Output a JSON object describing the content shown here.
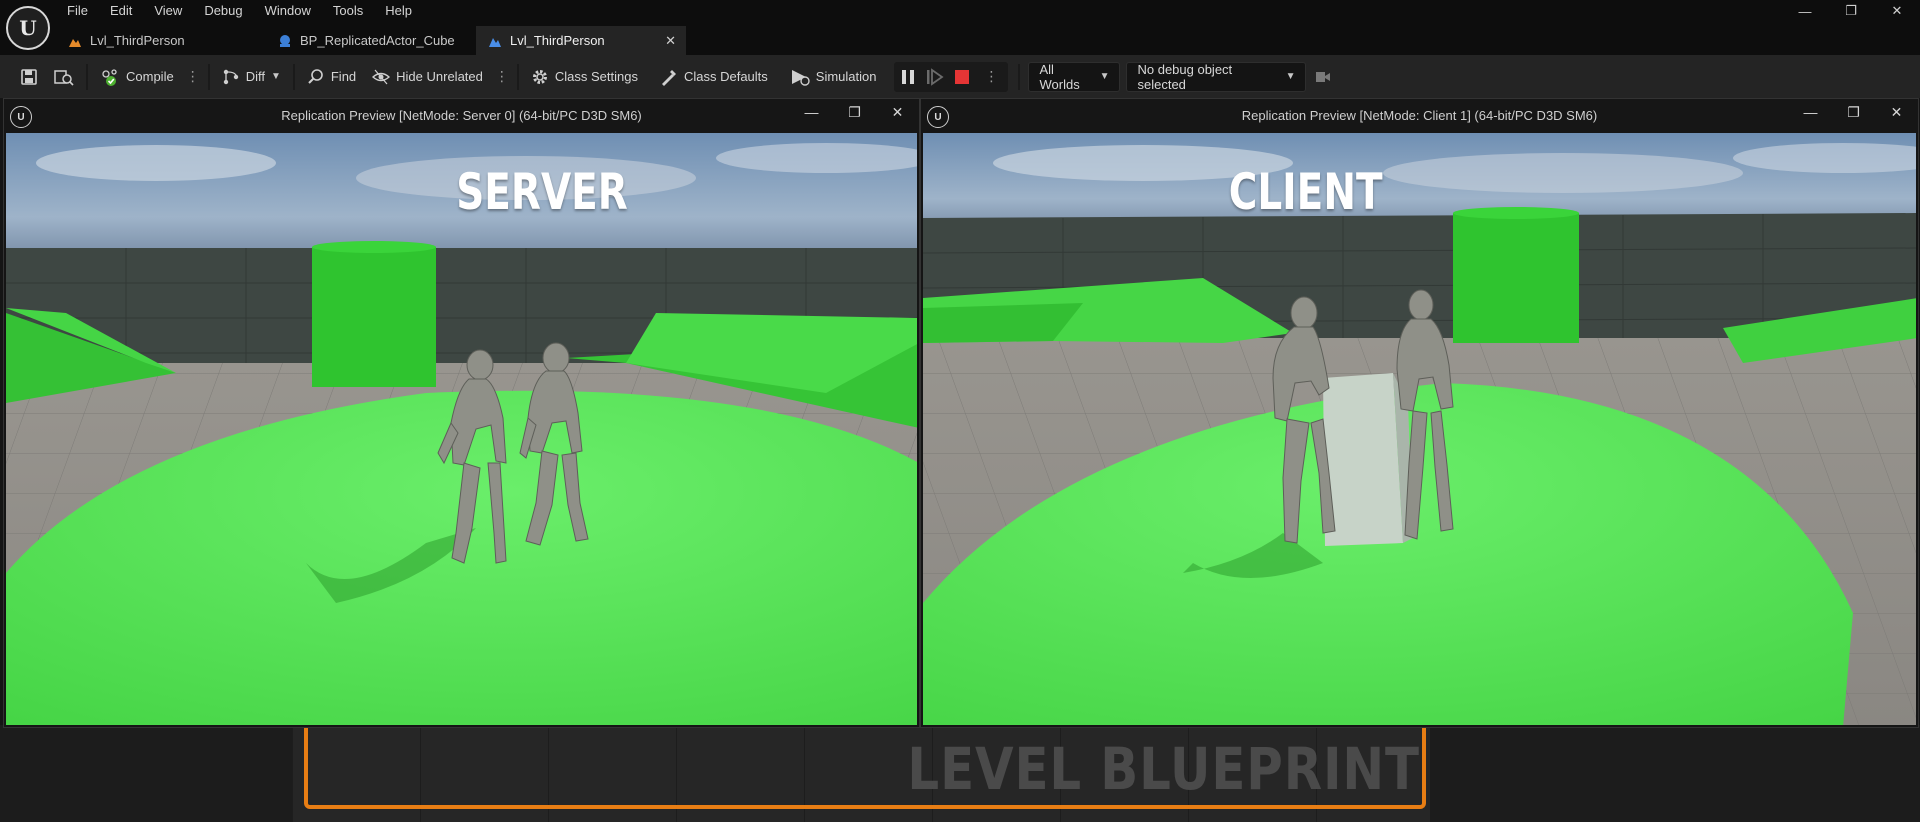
{
  "menu": [
    "File",
    "Edit",
    "View",
    "Debug",
    "Window",
    "Tools",
    "Help"
  ],
  "window_controls": {
    "minimize": "—",
    "maximize": "❐",
    "close": "✕"
  },
  "tabs": [
    {
      "label": "Lvl_ThirdPerson",
      "icon": "level-icon",
      "active": false
    },
    {
      "label": "BP_ReplicatedActor_Cube",
      "icon": "blueprint-icon",
      "active": false
    },
    {
      "label": "Lvl_ThirdPerson",
      "icon": "level-blueprint-icon",
      "active": true,
      "close": "✕"
    }
  ],
  "toolbar": {
    "compile": "Compile",
    "diff": "Diff",
    "find": "Find",
    "hide_unrelated": "Hide Unrelated",
    "class_settings": "Class Settings",
    "class_defaults": "Class Defaults",
    "simulation": "Simulation",
    "world_select": "All Worlds",
    "debug_object": "No debug object selected"
  },
  "graph": {
    "title": "LEVEL BLUEPRINT",
    "comment_color": "#e87e14"
  },
  "pie_windows": {
    "server": {
      "title": "Replication Preview [NetMode: Server 0]  (64-bit/PC D3D SM6)",
      "overlay_label": "SERVER"
    },
    "client": {
      "title": "Replication Preview [NetMode: Client 1]  (64-bit/PC D3D SM6)",
      "overlay_label": "CLIENT"
    }
  },
  "colors": {
    "floor_green": "#4fdc4f",
    "ground_grey": "#8a8886",
    "wall_dark": "#3d4541",
    "sky": "#7895b8",
    "stop_red": "#e53535"
  }
}
